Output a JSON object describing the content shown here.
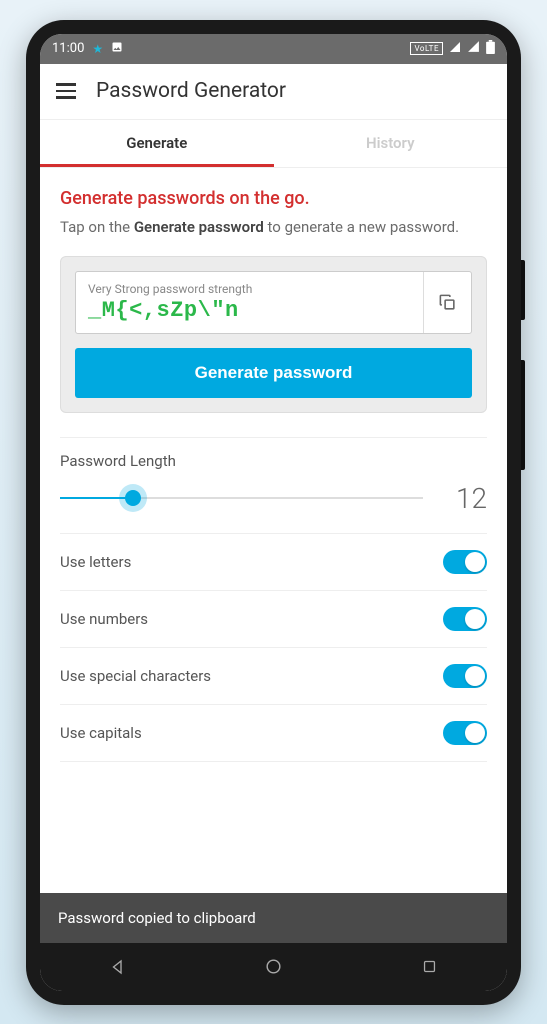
{
  "status_bar": {
    "time": "11:00",
    "volte_label": "VoLTE"
  },
  "header": {
    "title": "Password Generator"
  },
  "tabs": {
    "generate": "Generate",
    "history": "History"
  },
  "main": {
    "headline": "Generate passwords on the go.",
    "subtext_prefix": "Tap on the ",
    "subtext_bold": "Generate password",
    "subtext_suffix": " to generate a new password.",
    "strength_label": "Very Strong password strength",
    "password_value": "_M{<,sZp\\\"n",
    "generate_button": "Generate password"
  },
  "settings": {
    "length_label": "Password Length",
    "length_value": "12",
    "letters_label": "Use letters",
    "numbers_label": "Use numbers",
    "special_label": "Use special characters",
    "capitals_label": "Use capitals"
  },
  "toast": {
    "message": "Password copied to clipboard"
  }
}
